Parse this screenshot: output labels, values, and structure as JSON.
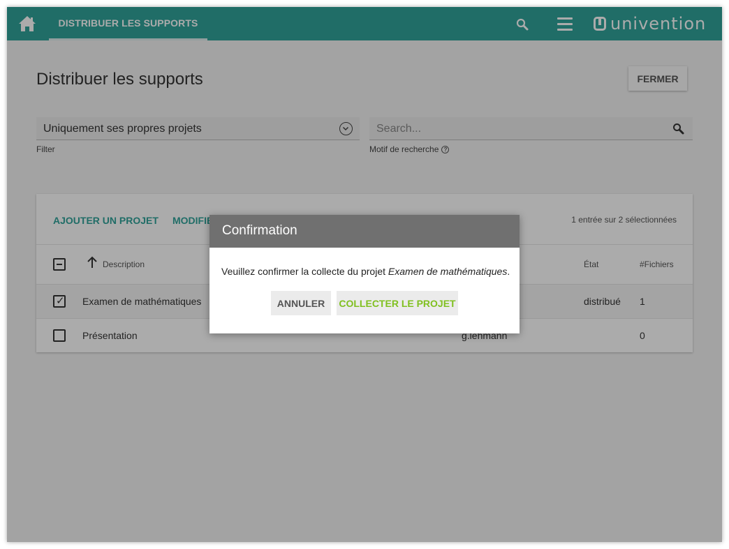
{
  "header": {
    "tab_label": "DISTRIBUER LES SUPPORTS",
    "logo_text": "univention",
    "accent_color": "#30a39a"
  },
  "page": {
    "title": "Distribuer les supports",
    "close_label": "FERMER"
  },
  "filter": {
    "value": "Uniquement ses propres projets",
    "label": "Filter"
  },
  "search": {
    "placeholder": "Search...",
    "label": "Motif de recherche"
  },
  "grid": {
    "actions": [
      "AJOUTER UN PROJET",
      "MODIFIER"
    ],
    "selection_status": "1 entrée sur 2 sélectionnées",
    "columns": {
      "description": "Description",
      "state": "État",
      "files": "#Fichiers"
    },
    "rows": [
      {
        "description": "Examen de mathématiques",
        "owner": "",
        "state": "distribué",
        "files": "1",
        "selected": true
      },
      {
        "description": "Présentation",
        "owner": "g.lehmann",
        "state": "",
        "files": "0",
        "selected": false
      }
    ]
  },
  "dialog": {
    "title": "Confirmation",
    "message_prefix": "Veuillez confirmer la collecte du projet ",
    "message_project": "Examen de mathématiques",
    "message_suffix": ".",
    "cancel_label": "ANNULER",
    "confirm_label": "COLLECTER LE PROJET",
    "confirm_color": "#80c020"
  }
}
